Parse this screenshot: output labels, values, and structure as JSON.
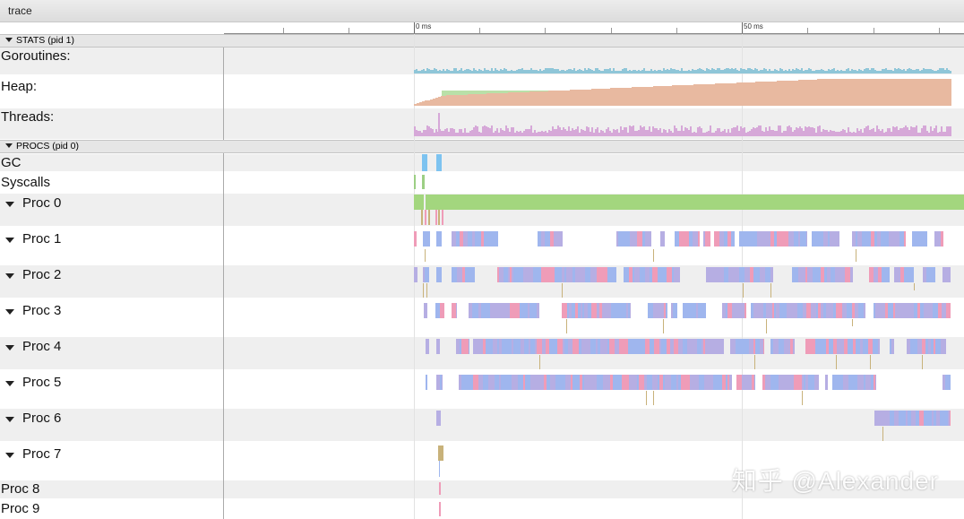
{
  "window": {
    "title": "trace"
  },
  "ruler": {
    "labels": [
      "0 ms",
      "50 ms"
    ]
  },
  "stats_section": {
    "label": "STATS (pid 1)"
  },
  "procs_section": {
    "label": "PROCS (pid 0)"
  },
  "counters": [
    {
      "label": "Goroutines:"
    },
    {
      "label": "Heap:"
    },
    {
      "label": "Threads:"
    }
  ],
  "rows": [
    {
      "label": "GC",
      "expandable": false
    },
    {
      "label": "Syscalls",
      "expandable": false
    },
    {
      "label": "Proc 0",
      "expandable": true
    },
    {
      "label": "Proc 1",
      "expandable": true
    },
    {
      "label": "Proc 2",
      "expandable": true
    },
    {
      "label": "Proc 3",
      "expandable": true
    },
    {
      "label": "Proc 4",
      "expandable": true
    },
    {
      "label": "Proc 5",
      "expandable": true
    },
    {
      "label": "Proc 6",
      "expandable": true
    },
    {
      "label": "Proc 7",
      "expandable": true
    },
    {
      "label": "Proc 8",
      "expandable": false
    },
    {
      "label": "Proc 9",
      "expandable": false
    }
  ],
  "colors": {
    "goroutines": "#8fc6d8",
    "heap_alloc": "#e8b9a0",
    "heap_next": "#b9e0a8",
    "threads": "#d6a8d8",
    "gc": "#7dc3f0",
    "syscall": "#9ccf84",
    "proc_green": "#a3d67e",
    "slice_pink": "#ef9cb8",
    "slice_blue": "#9fb6ee",
    "slice_lilac": "#b6aee3",
    "tick_line": "#c8b27a"
  },
  "watermark": "知乎 @Alexander"
}
